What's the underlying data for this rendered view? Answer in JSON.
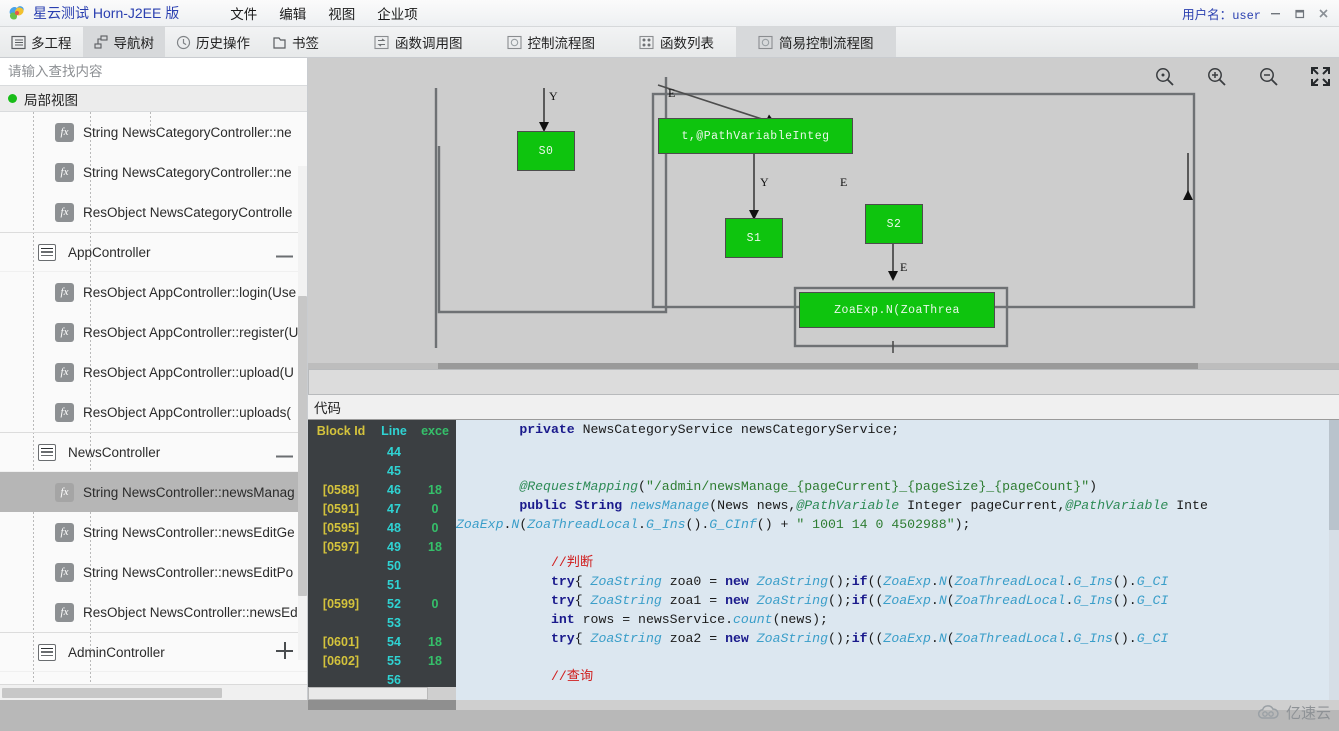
{
  "titlebar": {
    "app_title": "星云测试 Horn-J2EE 版",
    "menus": [
      "文件",
      "编辑",
      "视图",
      "企业项"
    ],
    "user_label": "用户名：",
    "user_name": "user",
    "minimize": "—",
    "maximize": "❐",
    "close": "✕"
  },
  "toolbar": {
    "buttons": [
      {
        "label": "多工程",
        "icon": "projects-icon",
        "selected": false
      },
      {
        "label": "导航树",
        "icon": "tree-icon",
        "selected": true
      },
      {
        "label": "历史操作",
        "icon": "clock-icon",
        "selected": false
      },
      {
        "label": "书签",
        "icon": "bookmark-icon",
        "selected": false
      }
    ],
    "tabs": [
      {
        "label": "函数调用图",
        "icon": "call-graph-icon",
        "active": false
      },
      {
        "label": "控制流程图",
        "icon": "control-flow-icon",
        "active": false
      },
      {
        "label": "函数列表",
        "icon": "function-list-icon",
        "active": false
      },
      {
        "label": "简易控制流程图",
        "icon": "simple-control-flow-icon",
        "active": true
      }
    ]
  },
  "sidebar": {
    "search_placeholder": "请输入查找内容",
    "search_value": "",
    "view_title": "局部视图",
    "tree": [
      {
        "type": "method",
        "label": "String NewsCategoryController::ne",
        "selected": false
      },
      {
        "type": "method",
        "label": "String NewsCategoryController::ne",
        "selected": false
      },
      {
        "type": "method",
        "label": "ResObject NewsCategoryControlle",
        "selected": false
      },
      {
        "type": "group",
        "label": "AppController",
        "toggle": "minus"
      },
      {
        "type": "method",
        "label": "ResObject AppController::login(Use",
        "selected": false
      },
      {
        "type": "method",
        "label": "ResObject AppController::register(U",
        "selected": false
      },
      {
        "type": "method",
        "label": "ResObject AppController::upload(U",
        "selected": false
      },
      {
        "type": "method",
        "label": "ResObject AppController::uploads(",
        "selected": false
      },
      {
        "type": "group",
        "label": "NewsController",
        "toggle": "minus"
      },
      {
        "type": "method",
        "label": "String NewsController::newsManag",
        "selected": true
      },
      {
        "type": "method",
        "label": "String NewsController::newsEditGe",
        "selected": false
      },
      {
        "type": "method",
        "label": "String NewsController::newsEditPo",
        "selected": false
      },
      {
        "type": "method",
        "label": "ResObject NewsController::newsEd",
        "selected": false
      },
      {
        "type": "group",
        "label": "AdminController",
        "toggle": "plus"
      }
    ]
  },
  "diagram": {
    "tools": [
      {
        "name": "zoom-actual-icon",
        "title": "原始大小"
      },
      {
        "name": "zoom-in-icon",
        "title": "放大"
      },
      {
        "name": "zoom-out-icon",
        "title": "缩小"
      },
      {
        "name": "fullscreen-icon",
        "title": "全屏"
      }
    ],
    "nodes": [
      {
        "id": "s0",
        "label": "S0"
      },
      {
        "id": "entry",
        "label": "t,@PathVariableInteg"
      },
      {
        "id": "s1",
        "label": "S1"
      },
      {
        "id": "s2",
        "label": "S2"
      },
      {
        "id": "zoa",
        "label": "ZoaExp.N(ZoaThrea"
      }
    ],
    "edge_labels": [
      "Y",
      "E",
      "Y",
      "E",
      "E"
    ],
    "node_color": "#0ec40e"
  },
  "code": {
    "panel_label": "代码",
    "gutter_headers": {
      "block": "Block Id",
      "line": "Line",
      "exce": "exce"
    },
    "rows": [
      {
        "block": "",
        "line": "44",
        "exce": ""
      },
      {
        "block": "",
        "line": "45",
        "exce": ""
      },
      {
        "block": "[0588]",
        "line": "46",
        "exce": "18"
      },
      {
        "block": "[0591]",
        "line": "47",
        "exce": "0"
      },
      {
        "block": "[0595]",
        "line": "48",
        "exce": "0"
      },
      {
        "block": "[0597]",
        "line": "49",
        "exce": "18"
      },
      {
        "block": "",
        "line": "50",
        "exce": ""
      },
      {
        "block": "",
        "line": "51",
        "exce": ""
      },
      {
        "block": "[0599]",
        "line": "52",
        "exce": "0"
      },
      {
        "block": "",
        "line": "53",
        "exce": ""
      },
      {
        "block": "[0601]",
        "line": "54",
        "exce": "18"
      },
      {
        "block": "[0602]",
        "line": "55",
        "exce": "18"
      },
      {
        "block": "",
        "line": "56",
        "exce": ""
      }
    ],
    "lines": [
      "        private NewsCategoryService newsCategoryService;",
      "",
      "",
      "        @RequestMapping(\"/admin/newsManage_{pageCurrent}_{pageSize}_{pageCount}\")",
      "        public String newsManage(News news,@PathVariable Integer pageCurrent,@PathVariable Inte",
      "ZoaExp.N(ZoaThreadLocal.G_Ins().G_CInf() + \" 1001 14 0 4502988\");",
      "",
      "            //判断",
      "            try{ ZoaString zoa0 = new ZoaString();if((ZoaExp.N(ZoaThreadLocal.G_Ins().G_CI",
      "            try{ ZoaString zoa1 = new ZoaString();if((ZoaExp.N(ZoaThreadLocal.G_Ins().G_CI",
      "            int rows = newsService.count(news);",
      "            try{ ZoaString zoa2 = new ZoaString();if((ZoaExp.N(ZoaThreadLocal.G_Ins().G_CI",
      "",
      "            //查询"
    ]
  },
  "watermark": {
    "text": "亿速云"
  }
}
